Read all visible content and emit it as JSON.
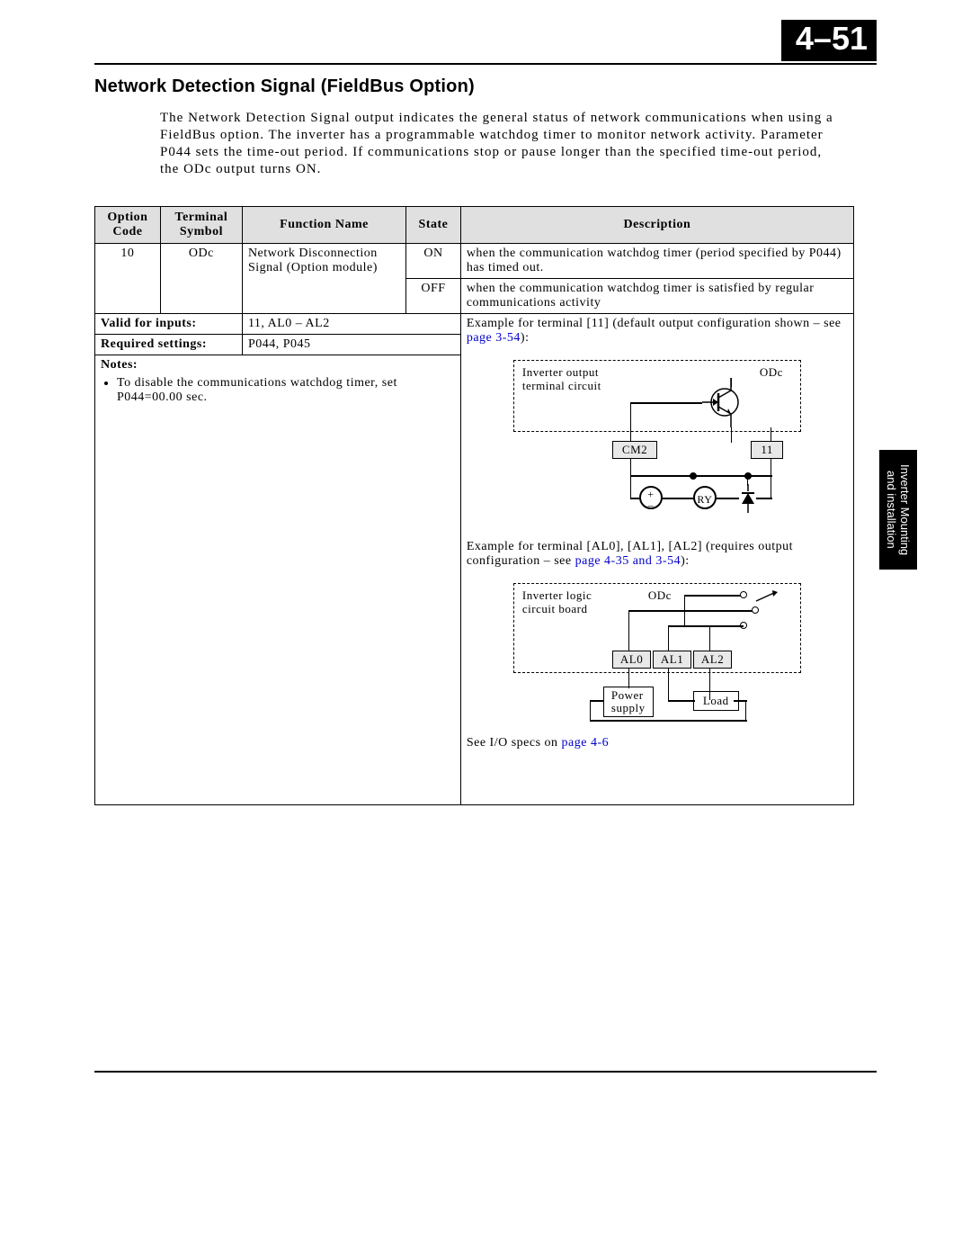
{
  "page_number": "4–51",
  "section_title": "Network Detection Signal (FieldBus Option)",
  "intro_text": "The Network Detection Signal output indicates the general status of network communications when using a FieldBus option. The inverter has a programmable watchdog timer to monitor network activity. Parameter P044 sets the time-out period. If communications stop or pause longer than the specified time-out period, the ODc output turns ON.",
  "headers": {
    "option_code": "Option Code",
    "terminal_symbol": "Terminal Symbol",
    "function_name": "Function Name",
    "state": "State",
    "description": "Description"
  },
  "row": {
    "option_code": "10",
    "terminal_symbol": "ODc",
    "function_name": "Network Disconnection Signal (Option module)",
    "state_on": "ON",
    "desc_on": "when the communication watchdog timer (period specified by P044) has timed out.",
    "state_off": "OFF",
    "desc_off": "when the communication watchdog timer is satisfied by regular communications activity"
  },
  "valid_for_inputs_label": "Valid for inputs:",
  "valid_for_inputs": "11, AL0 – AL2",
  "required_settings_label": "Required settings:",
  "required_settings": "P044, P045",
  "notes_label": "Notes:",
  "notes_bullet": "To disable the communications watchdog timer, set P044=00.00 sec.",
  "example1_pre": "Example for terminal [11] (default output configuration shown – see ",
  "example1_link": "page 3-54",
  "example1_post": "):",
  "diagram1": {
    "box_label_line1": "Inverter output",
    "box_label_line2": "terminal circuit",
    "odc": "ODc",
    "cm2": "CM2",
    "t11": "11",
    "ry": "RY",
    "plus": "+",
    "minus": "–"
  },
  "example2_pre": "Example for terminal [AL0], [AL1], [AL2] (requires output configuration – see ",
  "example2_link": "page 4-35 and 3-54",
  "example2_post": "):",
  "diagram2": {
    "box_label_line1": "Inverter logic",
    "box_label_line2": "circuit board",
    "odc": "ODc",
    "al0": "AL0",
    "al1": "AL1",
    "al2": "AL2",
    "power_supply": "Power\nsupply",
    "load": "Load"
  },
  "io_specs_pre": "See I/O specs on ",
  "io_specs_link": "page 4-6",
  "side_tab_line1": "Inverter Mounting",
  "side_tab_line2": "and installation"
}
